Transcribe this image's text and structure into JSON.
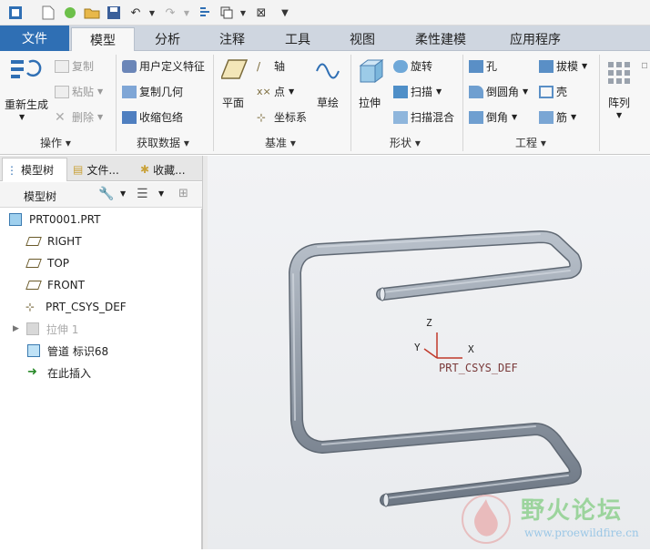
{
  "tabs": {
    "file": "文件",
    "model": "模型",
    "analysis": "分析",
    "annotate": "注释",
    "tools": "工具",
    "view": "视图",
    "flex": "柔性建模",
    "apps": "应用程序"
  },
  "ribbon": {
    "regenerate": "重新生成",
    "copy": "复制",
    "paste": "粘贴",
    "delete": "删除",
    "udf": "用户定义特征",
    "copy_geom": "复制几何",
    "shrinkwrap": "收缩包络",
    "plane": "平面",
    "axis": "轴",
    "point": "点",
    "csys": "坐标系",
    "sketch": "草绘",
    "extrude": "拉伸",
    "revolve": "旋转",
    "sweep": "扫描",
    "swept_blend": "扫描混合",
    "hole": "孔",
    "round": "倒圆角",
    "chamfer": "倒角",
    "draft": "拔模",
    "shell": "壳",
    "rib": "筋",
    "pattern": "阵列",
    "groups": {
      "operations": "操作",
      "get_data": "获取数据",
      "datum": "基准",
      "shapes": "形状",
      "engineering": "工程"
    }
  },
  "sidebar": {
    "tab_model_tree": "模型树",
    "tab_folder": "文件...",
    "tab_fav": "收藏...",
    "tree_label": "模型树"
  },
  "tree": {
    "root": "PRT0001.PRT",
    "right": "RIGHT",
    "top": "TOP",
    "front": "FRONT",
    "csys": "PRT_CSYS_DEF",
    "extrude": "拉伸 1",
    "pipe": "管道 标识68",
    "insert": "在此插入"
  },
  "viewport": {
    "csys_label": "PRT_CSYS_DEF",
    "axis_x": "X",
    "axis_y": "Y",
    "axis_z": "Z"
  },
  "watermark": {
    "title": "野火论坛",
    "url": "www.proewildfire.cn"
  },
  "colors": {
    "file_tab": "#2f6fb4",
    "pipe": "#8e98a4",
    "ribbon_bg": "#f7f7f7"
  }
}
